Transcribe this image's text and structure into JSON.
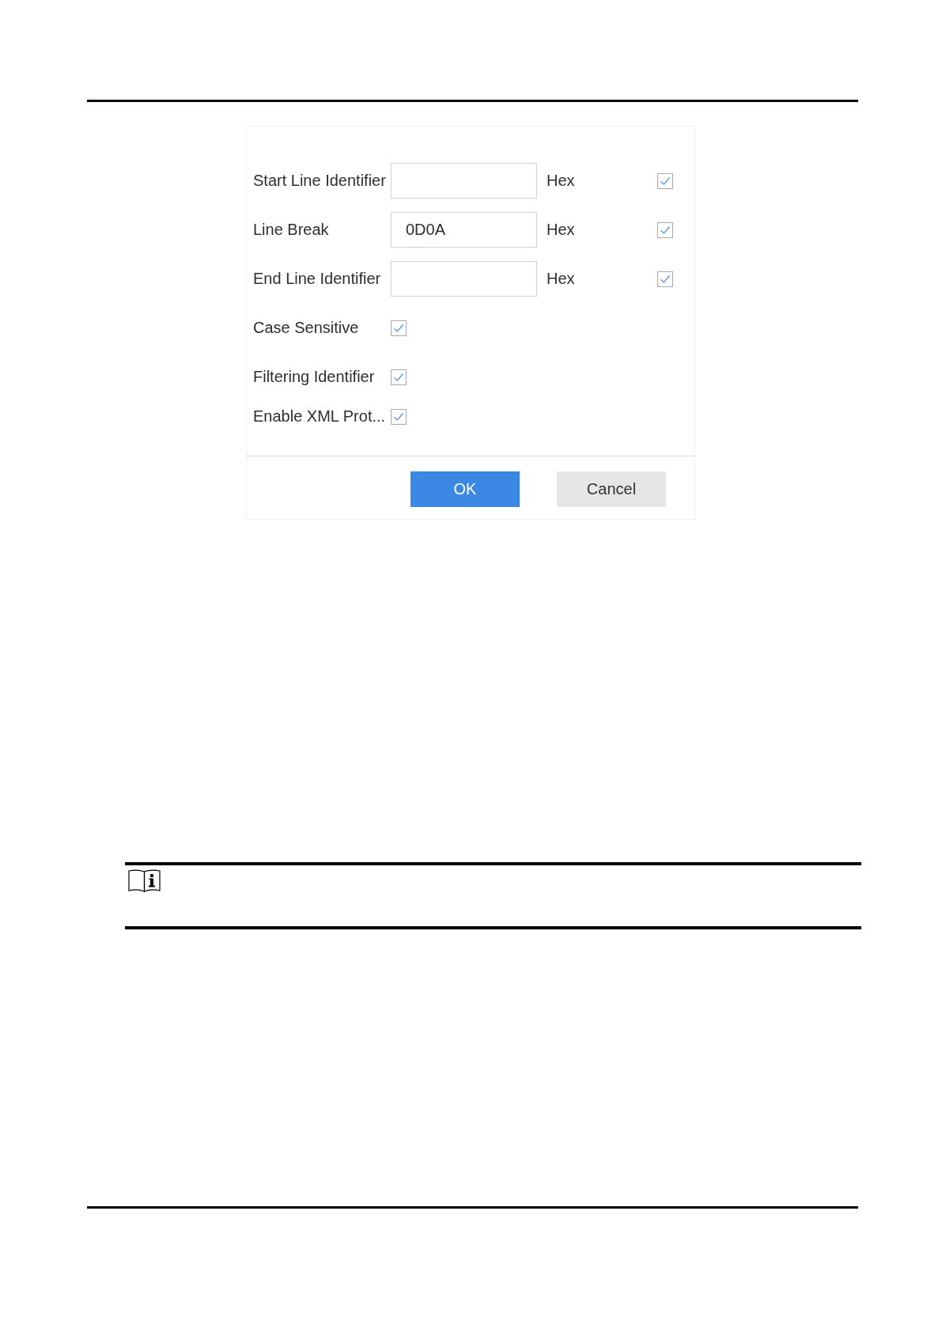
{
  "dialog": {
    "rows": [
      {
        "kind": "hex_input",
        "label": "Start Line Identifier",
        "unit": "Hex",
        "checked": true
      },
      {
        "kind": "hex_input",
        "label": "Line Break",
        "value": "0D0A",
        "unit": "Hex",
        "checked": true
      },
      {
        "kind": "hex_input",
        "label": "End Line Identifier",
        "unit": "Hex",
        "checked": true
      },
      {
        "kind": "checkbox",
        "label": "Case Sensitive",
        "checked": true
      },
      {
        "kind": "checkbox",
        "label": "Filtering Identifier",
        "checked": true
      },
      {
        "kind": "checkbox",
        "label": "Enable XML Prot...",
        "checked": true
      }
    ],
    "buttons": [
      {
        "label": "OK",
        "kind": "primary"
      },
      {
        "label": "Cancel",
        "kind": "secondary"
      }
    ]
  }
}
